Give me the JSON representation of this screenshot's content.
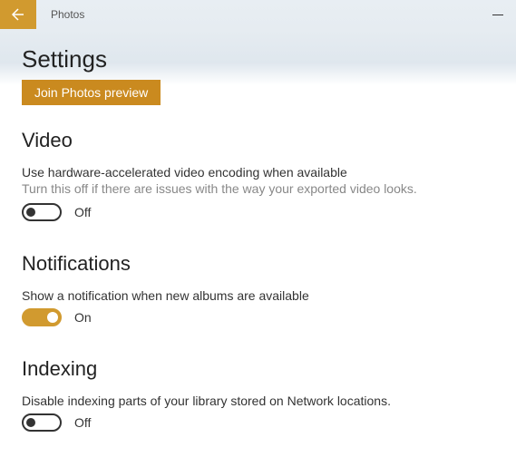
{
  "titlebar": {
    "app_name": "Photos"
  },
  "header": {
    "page_title": "Settings"
  },
  "preview_button": {
    "label": "Join Photos preview"
  },
  "sections": {
    "video": {
      "heading": "Video",
      "setting_title": "Use hardware-accelerated video encoding when available",
      "setting_desc": "Turn this off if there are issues with the way your exported video looks.",
      "toggle_state": "Off"
    },
    "notifications": {
      "heading": "Notifications",
      "setting_title": "Show a notification when new albums are available",
      "toggle_state": "On"
    },
    "indexing": {
      "heading": "Indexing",
      "setting_title": "Disable indexing parts of your library stored on Network locations.",
      "toggle_state": "Off"
    }
  }
}
